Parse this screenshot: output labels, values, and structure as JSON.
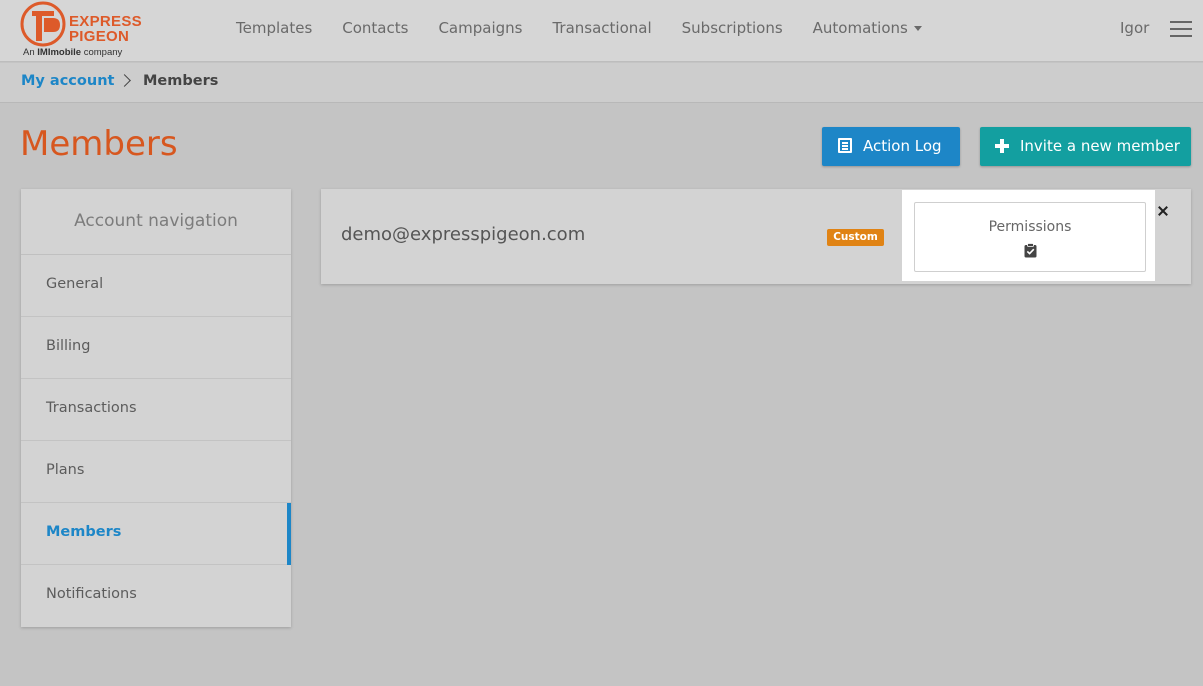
{
  "logo": {
    "word1": "EXPRESS",
    "word2": "PIGEON",
    "tagline_prefix": "An",
    "tagline_brand": "IMImobile",
    "tagline_suffix": "company"
  },
  "nav": {
    "items": [
      "Templates",
      "Contacts",
      "Campaigns",
      "Transactional",
      "Subscriptions",
      "Automations"
    ],
    "user": "Igor"
  },
  "breadcrumb": {
    "home": "My account",
    "current": "Members"
  },
  "page": {
    "title": "Members",
    "action_log_label": "Action Log",
    "invite_label": "Invite a new member"
  },
  "sidebar": {
    "title": "Account navigation",
    "items": [
      "General",
      "Billing",
      "Transactions",
      "Plans",
      "Members",
      "Notifications"
    ],
    "active": "Members"
  },
  "member": {
    "email": "demo@expresspigeon.com",
    "badge": "Custom",
    "permissions_label": "Permissions"
  },
  "colors": {
    "brand_orange": "#d7571f",
    "primary_blue": "#1d86c7",
    "teal": "#139fa0",
    "badge_orange": "#e08314"
  }
}
